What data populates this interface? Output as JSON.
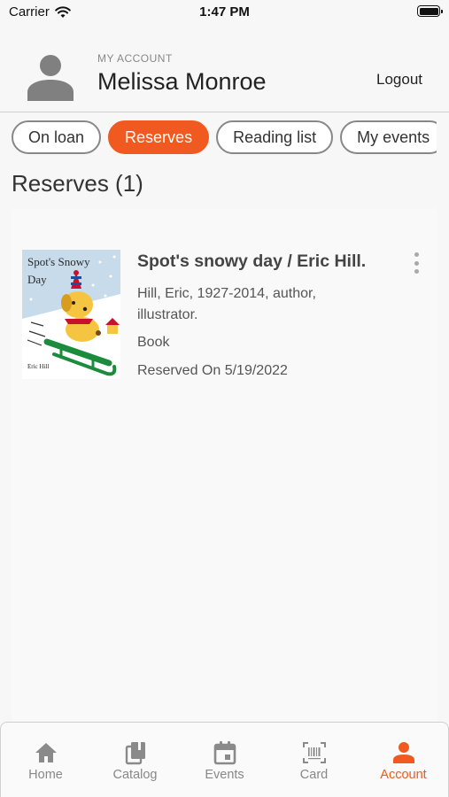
{
  "status_bar": {
    "carrier": "Carrier",
    "time": "1:47 PM",
    "wifi_icon": "wifi-icon",
    "battery_icon": "battery-icon"
  },
  "header": {
    "label": "MY ACCOUNT",
    "name": "Melissa Monroe",
    "logout": "Logout",
    "avatar_icon": "person-icon"
  },
  "tabs": [
    {
      "label": "On loan",
      "active": false
    },
    {
      "label": "Reserves",
      "active": true
    },
    {
      "label": "Reading list",
      "active": false
    },
    {
      "label": "My events",
      "active": false
    }
  ],
  "section": {
    "title": "Reserves (1)"
  },
  "reserves": [
    {
      "cover_title": "Spot's Snowy Day",
      "cover_author": "Eric Hill",
      "title": "Spot's snowy day / Eric Hill.",
      "author": "Hill, Eric, 1927-2014, author, illustrator.",
      "format": "Book",
      "reserved": "Reserved On 5/19/2022",
      "menu_icon": "more-vertical-icon"
    }
  ],
  "bottom_nav": [
    {
      "label": "Home",
      "icon": "home-icon",
      "active": false
    },
    {
      "label": "Catalog",
      "icon": "books-icon",
      "active": false
    },
    {
      "label": "Events",
      "icon": "calendar-icon",
      "active": false
    },
    {
      "label": "Card",
      "icon": "barcode-icon",
      "active": false
    },
    {
      "label": "Account",
      "icon": "person-icon",
      "active": true
    }
  ],
  "colors": {
    "accent": "#f0591f",
    "inactive_nav": "#888888",
    "background": "#f7f7f7"
  }
}
